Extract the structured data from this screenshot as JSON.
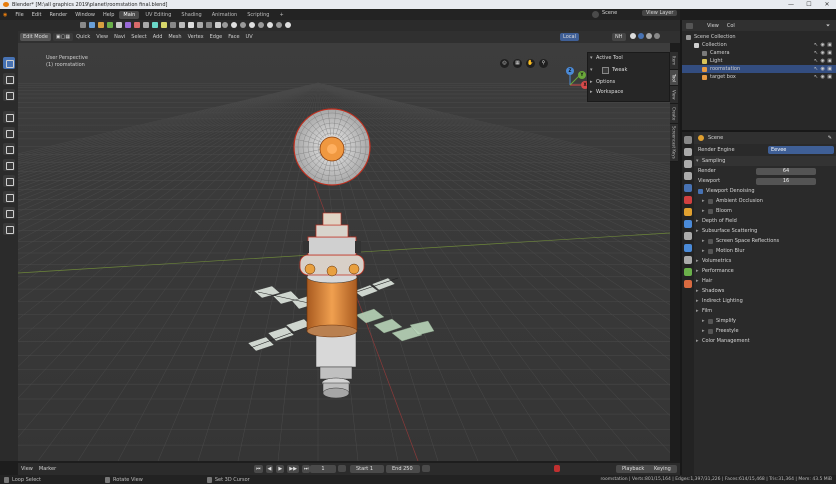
{
  "window": {
    "title": "Blender* [M:\\all graphics 2019\\planet\\roomstation final.blend]",
    "minimize": "—",
    "maximize": "☐",
    "close": "✕"
  },
  "menu": [
    "File",
    "Edit",
    "Render",
    "Window",
    "Help"
  ],
  "workspaces": {
    "tabs": [
      "Main",
      "UV Editing",
      "Shading",
      "Animation",
      "Scripting",
      "+"
    ],
    "active": "Main"
  },
  "topright": {
    "scene_label": "Scene",
    "layer_label": "View Layer",
    "layer_value": "Vi"
  },
  "viewport_header": {
    "mode": "Edit Mode",
    "menus": [
      "Quick",
      "View",
      "Navi",
      "Select",
      "Add",
      "Mesh",
      "Vertex",
      "Edge",
      "Face",
      "UV"
    ],
    "orientation": "Local",
    "pivot": "NH"
  },
  "viewport": {
    "view_name": "User Perspective",
    "object_name": "(1) roomstation"
  },
  "npanel": {
    "sections": [
      {
        "label": "Active Tool",
        "open": true
      },
      {
        "label": "Tweak",
        "open": true
      },
      {
        "label": "Options",
        "open": false
      },
      {
        "label": "Workspace",
        "open": false
      }
    ],
    "tabs": [
      "Item",
      "Tool",
      "View",
      "Create",
      "Screencast Keys"
    ]
  },
  "outliner": {
    "header": {
      "view": "View",
      "col": "Col"
    },
    "items": [
      {
        "label": "Scene Collection",
        "indent": 0,
        "color": "#9a9a9a",
        "selected": false
      },
      {
        "label": "Collection",
        "indent": 1,
        "color": "#d0d0d0",
        "selected": false
      },
      {
        "label": "Camera",
        "indent": 2,
        "color": "#7a7a7a",
        "selected": false
      },
      {
        "label": "Light",
        "indent": 2,
        "color": "#d8c35a",
        "selected": false
      },
      {
        "label": "roomstation",
        "indent": 2,
        "color": "#e89a43",
        "selected": true
      },
      {
        "label": "target box",
        "indent": 2,
        "color": "#e89a43",
        "selected": false
      }
    ]
  },
  "properties": {
    "context": "Scene",
    "render_engine_label": "Render Engine",
    "render_engine_value": "Eevee",
    "sampling_label": "Sampling",
    "render_label": "Render",
    "render_value": "64",
    "viewport_label": "Viewport",
    "viewport_value": "16",
    "denoise_label": "Viewport Denoising",
    "sections": [
      {
        "label": "Ambient Occlusion",
        "check": true,
        "sub": true
      },
      {
        "label": "Bloom",
        "check": true,
        "sub": true
      },
      {
        "label": "Depth of Field",
        "check": false,
        "sub": false
      },
      {
        "label": "Subsurface Scattering",
        "check": false,
        "sub": false
      },
      {
        "label": "Screen Space Reflections",
        "check": true,
        "sub": true
      },
      {
        "label": "Motion Blur",
        "check": true,
        "sub": true
      },
      {
        "label": "Volumetrics",
        "check": false,
        "sub": false
      },
      {
        "label": "Performance",
        "check": false,
        "sub": false
      },
      {
        "label": "Hair",
        "check": false,
        "sub": false
      },
      {
        "label": "Shadows",
        "check": false,
        "sub": false
      },
      {
        "label": "Indirect Lighting",
        "check": false,
        "sub": false
      },
      {
        "label": "Film",
        "check": false,
        "sub": false
      },
      {
        "label": "Simplify",
        "check": true,
        "sub": true
      },
      {
        "label": "Freestyle",
        "check": true,
        "sub": true
      },
      {
        "label": "Color Management",
        "check": false,
        "sub": false
      }
    ]
  },
  "timeline": {
    "view": "View",
    "marker": "Marker",
    "current_frame": "1",
    "start_label": "Start",
    "start_value": "1",
    "end_label": "End",
    "end_value": "250",
    "playback": "Playback",
    "keying": "Keying"
  },
  "statusbar": {
    "left1": "Loop Select",
    "left2": "Rotate View",
    "left3": "Set 3D Cursor",
    "stats": "roomstation | Verts:801/15,164 | Edges:1,397/31,226 | Faces:614/15,468 | Tris:31,364 | Mem: 43.5 MiB"
  },
  "gizmo": {
    "x": "X",
    "y": "Y",
    "z": "Z"
  }
}
